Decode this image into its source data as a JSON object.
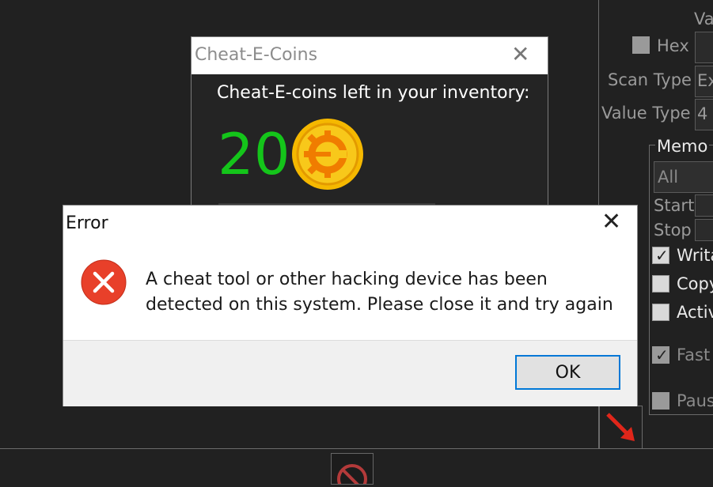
{
  "right_panel": {
    "value_label_partial": "Va",
    "hex_label": "Hex",
    "scan_type_label": "Scan Type",
    "scan_type_value_partial": "Ex",
    "value_type_label": "Value Type",
    "value_type_value_partial": "4",
    "memory_group_label_partial": "Memo",
    "memory_region_value": "All",
    "start_label": "Start",
    "stop_label": "Stop",
    "writable_label_partial": "Writa",
    "copy_label_partial": "Copy",
    "active_label_partial": "Activ",
    "fast_label_partial": "Fast",
    "pause_label_partial": "Paus"
  },
  "coins_window": {
    "title": "Cheat-E-Coins",
    "close_glyph": "✕",
    "caption": "Cheat-E-coins left in your inventory:",
    "count": "20",
    "coin_color": "#f5b800",
    "count_color": "#14c51a"
  },
  "error_dialog": {
    "title": "Error",
    "close_glyph": "✕",
    "message": "A cheat tool or other hacking device has been detected on this system. Please close it and try again",
    "ok_label": "OK",
    "icon": "error-x-icon",
    "icon_color": "#e8402a"
  }
}
